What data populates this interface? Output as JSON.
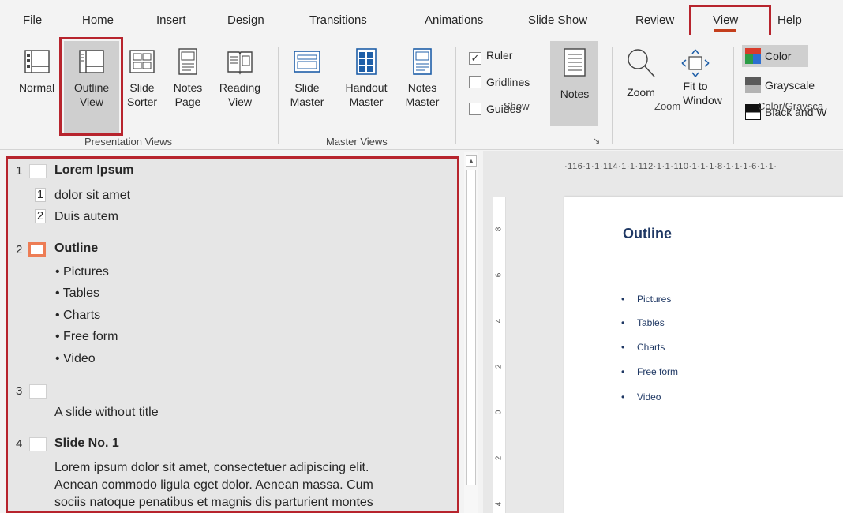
{
  "tabs": [
    "File",
    "Home",
    "Insert",
    "Design",
    "Transitions",
    "Animations",
    "Slide Show",
    "Review",
    "View",
    "Help"
  ],
  "active_tab": "View",
  "ribbon": {
    "presentation_views": {
      "label": "Presentation Views",
      "buttons": [
        {
          "line1": "Normal",
          "line2": ""
        },
        {
          "line1": "Outline",
          "line2": "View"
        },
        {
          "line1": "Slide",
          "line2": "Sorter"
        },
        {
          "line1": "Notes",
          "line2": "Page"
        },
        {
          "line1": "Reading",
          "line2": "View"
        }
      ],
      "selected": "Outline View"
    },
    "master_views": {
      "label": "Master Views",
      "buttons": [
        {
          "line1": "Slide",
          "line2": "Master"
        },
        {
          "line1": "Handout",
          "line2": "Master"
        },
        {
          "line1": "Notes",
          "line2": "Master"
        }
      ]
    },
    "show": {
      "label": "Show",
      "checkboxes": [
        {
          "label": "Ruler",
          "checked": true
        },
        {
          "label": "Gridlines",
          "checked": false
        },
        {
          "label": "Guides",
          "checked": false
        }
      ],
      "notes_button": "Notes"
    },
    "zoom": {
      "label": "Zoom",
      "zoom_button": "Zoom",
      "fit_line1": "Fit to",
      "fit_line2": "Window"
    },
    "color_grayscale": {
      "label": "Color/Graysca",
      "items": [
        {
          "label": "Color",
          "selected": true
        },
        {
          "label": "Grayscale",
          "selected": false
        },
        {
          "label": "Black and W",
          "selected": false
        }
      ]
    }
  },
  "outline": {
    "slides": [
      {
        "number": "1",
        "title": "Lorem Ipsum",
        "items": [
          {
            "num": "1",
            "text": "dolor sit amet"
          },
          {
            "num": "2",
            "text": "Duis autem"
          }
        ]
      },
      {
        "number": "2",
        "title": "Outline",
        "bullets": [
          "• Pictures",
          "• Tables",
          "• Charts",
          "• Free form",
          "• Video"
        ]
      },
      {
        "number": "3",
        "title": "",
        "body": "A slide without title"
      },
      {
        "number": "4",
        "title": "Slide No. 1",
        "body_lines": [
          "Lorem ipsum dolor sit amet, consectetuer adipiscing elit.",
          "Aenean commodo ligula eget dolor. Aenean massa. Cum",
          "sociis natoque penatibus et magnis dis parturient montes"
        ]
      }
    ]
  },
  "ruler": {
    "horizontal": "·116·1·1·114·1·1·112·1·1·110·1·1·1·8·1·1·1·6·1·1·",
    "vertical_ticks": [
      "8",
      "6",
      "4",
      "2",
      "0",
      "2",
      "4"
    ]
  },
  "slide": {
    "title": "Outline",
    "bullets": [
      "Pictures",
      "Tables",
      "Charts",
      "Free form",
      "Video"
    ],
    "bullet_char": "•"
  },
  "colors": {
    "highlight": "#b7242d",
    "tab_underline": "#c43e1c",
    "slide_title": "#1f3864",
    "active_thumb": "#ed7d55"
  }
}
